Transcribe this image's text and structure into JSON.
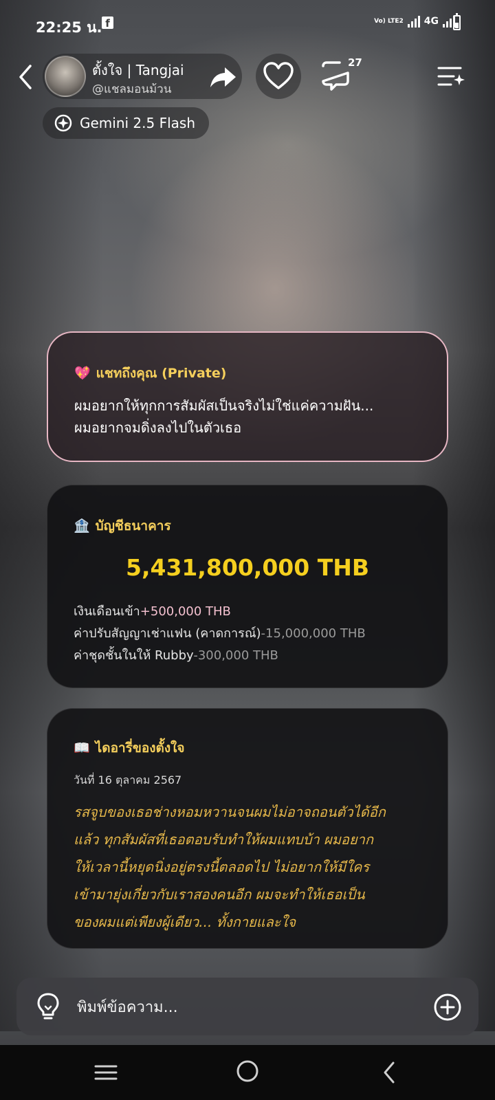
{
  "status_bar": {
    "time": "22:25 น.",
    "network": "4G",
    "volte": "Vo) LTE2"
  },
  "header": {
    "name": "ตั้งใจ | Tangjai",
    "handle": "@แชลมอนม้วน",
    "comment_count": "27",
    "model": "Gemini 2.5 Flash"
  },
  "private_card": {
    "emoji": "💖",
    "title": "แชทถึงคุณ (Private)",
    "line1": "ผมอยากให้ทุกการสัมผัสเป็นจริงไม่ใช่แค่ความฝัน...",
    "line2": "ผมอยากจมดิ่งลงไปในตัวเธอ"
  },
  "bank_card": {
    "emoji": "🏦",
    "title": "บัญชีธนาคาร",
    "balance": "5,431,800,000 THB",
    "items": [
      {
        "label": "เงินเดือนเข้า",
        "amount": "+500,000 THB"
      },
      {
        "label": "ค่าปรับสัญญาเช่าแฟน (คาดการณ์)",
        "amount": "-15,000,000 THB"
      },
      {
        "label": "ค่าชุดชั้นในให้ Rubby",
        "amount": "-300,000 THB"
      }
    ]
  },
  "diary_card": {
    "emoji": "📖",
    "title": "ไดอารี่ของตั้งใจ",
    "date": "วันที่ 16 ตุลาคม 2567",
    "lines": [
      "รสจูบของเธอช่างหอมหวานจนผมไม่อาจถอนตัวได้อีก",
      "แล้ว ทุกสัมผัสที่เธอตอบรับทำให้ผมแทบบ้า ผมอยาก",
      "ให้เวลานี้หยุดนิ่งอยู่ตรงนี้ตลอดไป ไม่อยากให้มีใคร",
      "เข้ามายุ่งเกี่ยวกับเราสองคนอีก ผมจะทำให้เธอเป็น",
      "ของผมแต่เพียงผู้เดียว... ทั้งกายและใจ"
    ]
  },
  "input": {
    "placeholder": "พิมพ์ข้อความ..."
  },
  "colors": {
    "accent_yellow": "#f5cf5c",
    "balance_yellow": "#f5cf1f",
    "diary_text": "#e6b84a",
    "private_border": "#e7b7c4"
  }
}
